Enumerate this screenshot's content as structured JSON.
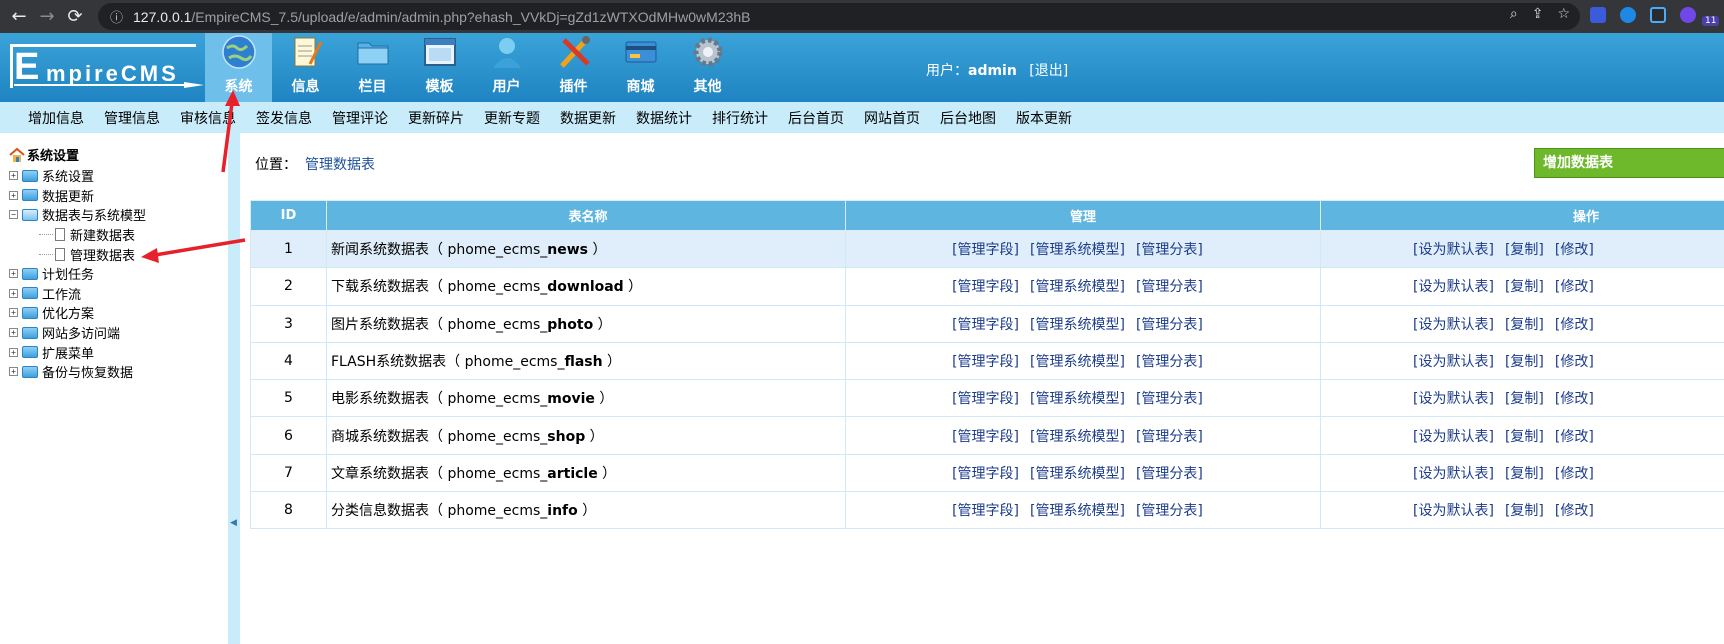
{
  "browser": {
    "url_host": "127.0.0.1",
    "url_path": "/EmpireCMS_7.5/upload/e/admin/admin.php?ehash_VVkDj=gZd1zWTXOdMHw0wM23hB",
    "ext_badge": "11"
  },
  "header": {
    "logo_text": "mpireCMS",
    "logo_E": "E",
    "nav": [
      {
        "label": "系统",
        "icon": "globe-icon",
        "active": true
      },
      {
        "label": "信息",
        "icon": "notepad-icon"
      },
      {
        "label": "栏目",
        "icon": "folder-icon"
      },
      {
        "label": "模板",
        "icon": "window-icon"
      },
      {
        "label": "用户",
        "icon": "user-icon"
      },
      {
        "label": "插件",
        "icon": "tools-icon"
      },
      {
        "label": "商城",
        "icon": "card-icon"
      },
      {
        "label": "其他",
        "icon": "gear-icon"
      }
    ],
    "user_prefix": "用户：",
    "username": "admin",
    "logout": "[退出]"
  },
  "submenu": [
    "增加信息",
    "管理信息",
    "审核信息",
    "签发信息",
    "管理评论",
    "更新碎片",
    "更新专题",
    "数据更新",
    "数据统计",
    "排行统计",
    "后台首页",
    "网站首页",
    "后台地图",
    "版本更新"
  ],
  "tree": {
    "root": "系统设置",
    "nodes": [
      {
        "label": "系统设置",
        "expanded": false
      },
      {
        "label": "数据更新",
        "expanded": false
      },
      {
        "label": "数据表与系统模型",
        "expanded": true,
        "children": [
          "新建数据表",
          "管理数据表"
        ]
      },
      {
        "label": "计划任务",
        "expanded": false
      },
      {
        "label": "工作流",
        "expanded": false
      },
      {
        "label": "优化方案",
        "expanded": false
      },
      {
        "label": "网站多访问端",
        "expanded": false
      },
      {
        "label": "扩展菜单",
        "expanded": false
      },
      {
        "label": "备份与恢复数据",
        "expanded": false
      }
    ]
  },
  "main": {
    "position_label": "位置：",
    "position_link": "管理数据表",
    "add_button": "增加数据表",
    "columns": [
      "ID",
      "表名称",
      "管理",
      "操作"
    ],
    "manage_links": [
      "[管理字段]",
      "[管理系统模型]",
      "[管理分表]"
    ],
    "op_links": [
      "[设为默认表]",
      "[复制]",
      "[修改]"
    ],
    "rows": [
      {
        "id": "1",
        "name": "新闻系统数据表",
        "prefix": "phome_ecms_",
        "table": "news"
      },
      {
        "id": "2",
        "name": "下载系统数据表",
        "prefix": "phome_ecms_",
        "table": "download"
      },
      {
        "id": "3",
        "name": "图片系统数据表",
        "prefix": "phome_ecms_",
        "table": "photo"
      },
      {
        "id": "4",
        "name": "FLASH系统数据表",
        "prefix": "phome_ecms_",
        "table": "flash"
      },
      {
        "id": "5",
        "name": "电影系统数据表",
        "prefix": "phome_ecms_",
        "table": "movie"
      },
      {
        "id": "6",
        "name": "商城系统数据表",
        "prefix": "phome_ecms_",
        "table": "shop"
      },
      {
        "id": "7",
        "name": "文章系统数据表",
        "prefix": "phome_ecms_",
        "table": "article"
      },
      {
        "id": "8",
        "name": "分类信息数据表",
        "prefix": "phome_ecms_",
        "table": "info"
      }
    ]
  },
  "colors": {
    "header": "#2a95cf",
    "submenu": "#c9ecfb",
    "table_header": "#5db5e0",
    "link": "#1c3c8a",
    "annotation": "#e8202a"
  }
}
